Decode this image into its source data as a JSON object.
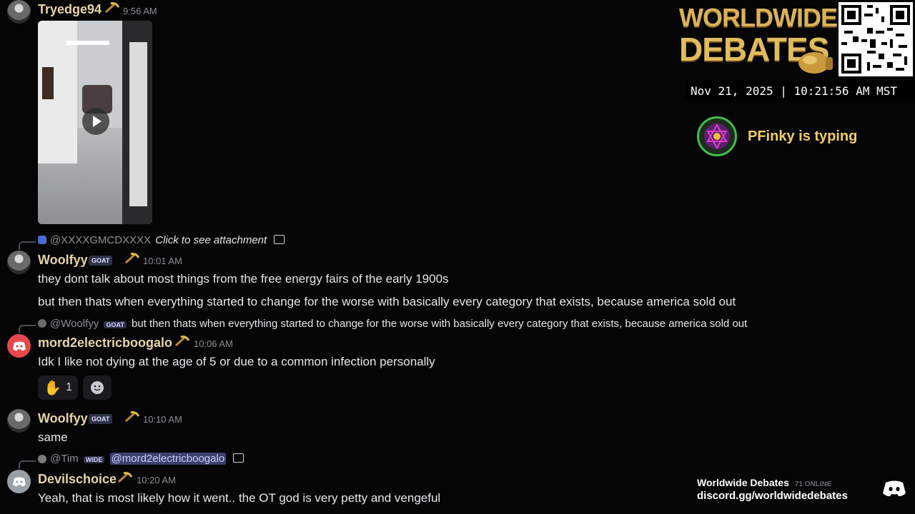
{
  "messages": {
    "m1": {
      "author": "Tryedge94",
      "time": "9:56 AM",
      "video_play": "play-icon"
    },
    "m2": {
      "reply_to": "@XXXXGMCDXXXX",
      "reply_text": "Click to see attachment",
      "author": "Woolfyy",
      "badge": "GOAT",
      "time": "10:01 AM",
      "line1": "they dont talk about most things from the free energy fairs of the early 1900s",
      "line2": "but then thats when everything started to change for the worse with basically every category that exists, because america sold out"
    },
    "m3": {
      "reply_to": "@Woolfyy",
      "reply_badge": "GOAT",
      "reply_text": "but then thats when everything started to change for the worse with basically every category that exists, because america sold out",
      "author": "mord2electricboogalo",
      "time": "10:06 AM",
      "text": "Idk I like not dying at the age of 5 or due to a common infection personally",
      "reaction_count": "1"
    },
    "m4": {
      "author": "Woolfyy",
      "badge": "GOAT",
      "time": "10:10 AM",
      "text": "same"
    },
    "m5": {
      "reply_to": "@Tim",
      "reply_badge": "WIDE",
      "reply_mention": "@mord2electricboogalo",
      "author": "Devilschoice",
      "time": "10:20 AM",
      "text": "Yeah, that is most likely how it went.. the OT god is very petty and vengeful"
    }
  },
  "overlay": {
    "logo_line1": "WORLDWIDE",
    "logo_line2": "DEBATES",
    "datetime": "Nov 21, 2025 | 10:21:56 AM MST",
    "typing": "PFinky is typing",
    "server_name": "Worldwide Debates",
    "online": "71 ONLINE",
    "invite": "discord.gg/worldwidedebates"
  },
  "colors": {
    "author": "#e7d3a6",
    "mention_bg": "#3c4270",
    "gold": "#d4a94a",
    "background": "#050506"
  }
}
